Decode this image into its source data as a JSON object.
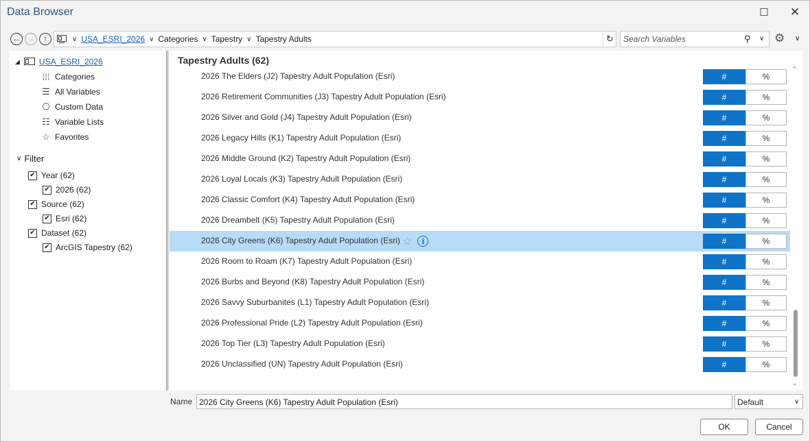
{
  "window": {
    "title": "Data Browser"
  },
  "nav": {
    "path": [
      "USA_ESRI_2026",
      "Categories",
      "Tapestry",
      "Tapestry Adults"
    ],
    "search_placeholder": "Search Variables"
  },
  "sidebar": {
    "root": "USA_ESRI_2026",
    "items": [
      {
        "label": "Categories",
        "icon": "grid-dots-icon"
      },
      {
        "label": "All Variables",
        "icon": "list-icon"
      },
      {
        "label": "Custom Data",
        "icon": "custom-data-icon"
      },
      {
        "label": "Variable Lists",
        "icon": "variable-lists-icon"
      },
      {
        "label": "Favorites",
        "icon": "star-icon"
      }
    ],
    "filter_label": "Filter",
    "filters": [
      {
        "label": "Year (62)",
        "checked": true,
        "level": 0
      },
      {
        "label": "2026 (62)",
        "checked": true,
        "level": 1
      },
      {
        "label": "Source (62)",
        "checked": true,
        "level": 0
      },
      {
        "label": "Esri (62)",
        "checked": true,
        "level": 1
      },
      {
        "label": "Dataset (62)",
        "checked": true,
        "level": 0
      },
      {
        "label": "ArcGIS Tapestry (62)",
        "checked": true,
        "level": 1
      }
    ]
  },
  "list": {
    "header": "Tapestry Adults (62)",
    "hash_label": "#",
    "pct_label": "%",
    "rows": [
      "2026 The Elders (J2) Tapestry Adult Population (Esri)",
      "2026 Retirement Communities (J3) Tapestry Adult Population (Esri)",
      "2026 Silver and Gold (J4) Tapestry Adult Population (Esri)",
      "2026 Legacy Hills (K1) Tapestry Adult Population (Esri)",
      "2026 Middle Ground (K2) Tapestry Adult Population (Esri)",
      "2026 Loyal Locals (K3) Tapestry Adult Population (Esri)",
      "2026 Classic Comfort (K4) Tapestry Adult Population (Esri)",
      "2026 Dreambelt (K5) Tapestry Adult Population (Esri)",
      "2026 City Greens (K6) Tapestry Adult Population (Esri)",
      "2026 Room to Roam (K7) Tapestry Adult Population (Esri)",
      "2026 Burbs and Beyond (K8) Tapestry Adult Population (Esri)",
      "2026 Savvy Suburbanites (L1) Tapestry Adult Population (Esri)",
      "2026 Professional Pride (L2) Tapestry Adult Population (Esri)",
      "2026 Top Tier (L3) Tapestry Adult Population (Esri)",
      "2026 Unclassified (UN) Tapestry Adult Population (Esri)"
    ],
    "selected_index": 8
  },
  "footer": {
    "name_label": "Name",
    "name_value": "2026 City Greens (K6) Tapestry Adult Population (Esri)",
    "format_value": "Default",
    "ok_label": "OK",
    "cancel_label": "Cancel"
  },
  "colors": {
    "accent": "#0f74c7",
    "selected_row": "#b8dcf5",
    "link": "#1a5fb4"
  }
}
